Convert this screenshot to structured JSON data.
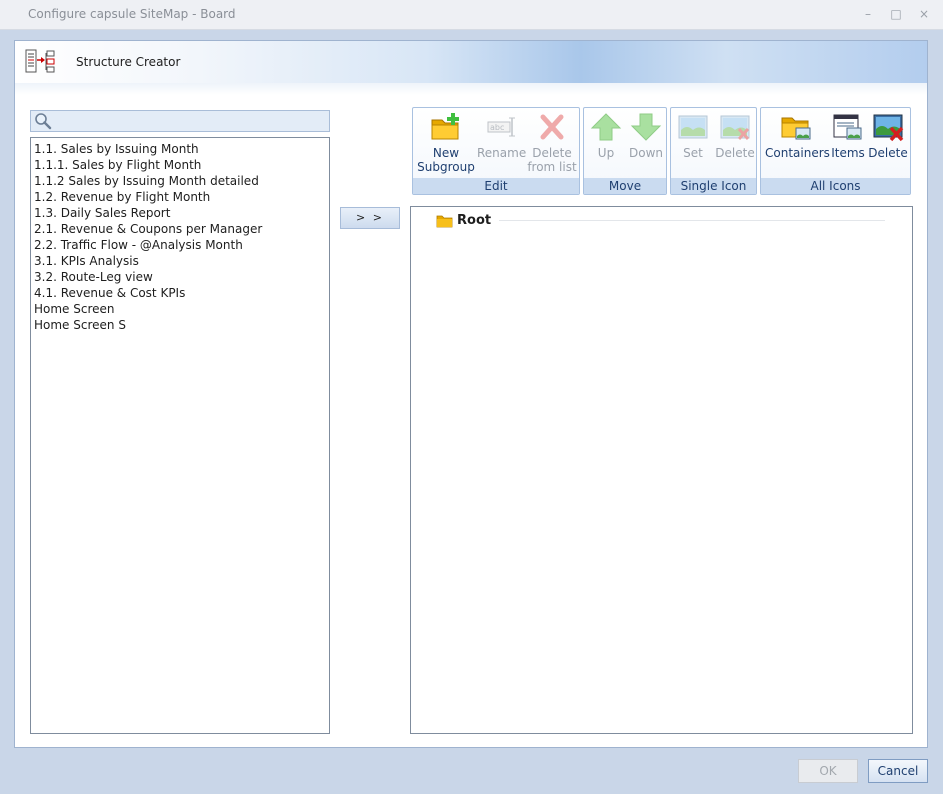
{
  "window": {
    "title": "Configure capsule SiteMap - Board",
    "minimize": "–",
    "maximize": "□",
    "close": "×"
  },
  "header": {
    "title": "Structure Creator"
  },
  "search": {
    "value": "",
    "placeholder": ""
  },
  "list": {
    "items": [
      "1.1. Sales by Issuing Month",
      "1.1.1. Sales by Flight Month",
      "1.1.2 Sales by Issuing Month detailed",
      "1.2. Revenue by Flight Month",
      "1.3. Daily Sales Report",
      "2.1. Revenue & Coupons per Manager",
      "2.2. Traffic Flow - @Analysis Month",
      "3.1. KPIs Analysis",
      "3.2. Route-Leg view",
      "4.1. Revenue & Cost KPIs",
      "Home Screen",
      "Home Screen S"
    ]
  },
  "move_button": {
    "label": "> >"
  },
  "ribbon": {
    "edit": {
      "label": "Edit",
      "new_subgroup_line1": "New",
      "new_subgroup_line2": "Subgroup",
      "rename": "Rename",
      "delete_line1": "Delete",
      "delete_line2": "from list"
    },
    "move": {
      "label": "Move",
      "up": "Up",
      "down": "Down"
    },
    "single_icon": {
      "label": "Single Icon",
      "set": "Set",
      "delete": "Delete"
    },
    "all_icons": {
      "label": "All Icons",
      "containers": "Containers",
      "items": "Items",
      "delete": "Delete"
    }
  },
  "tree": {
    "root_label": "Root"
  },
  "footer": {
    "ok": "OK",
    "cancel": "Cancel"
  },
  "colors": {
    "accent": "#1f3f70",
    "ribbon_group": "#cadbf0",
    "folder": "#f2b400"
  }
}
